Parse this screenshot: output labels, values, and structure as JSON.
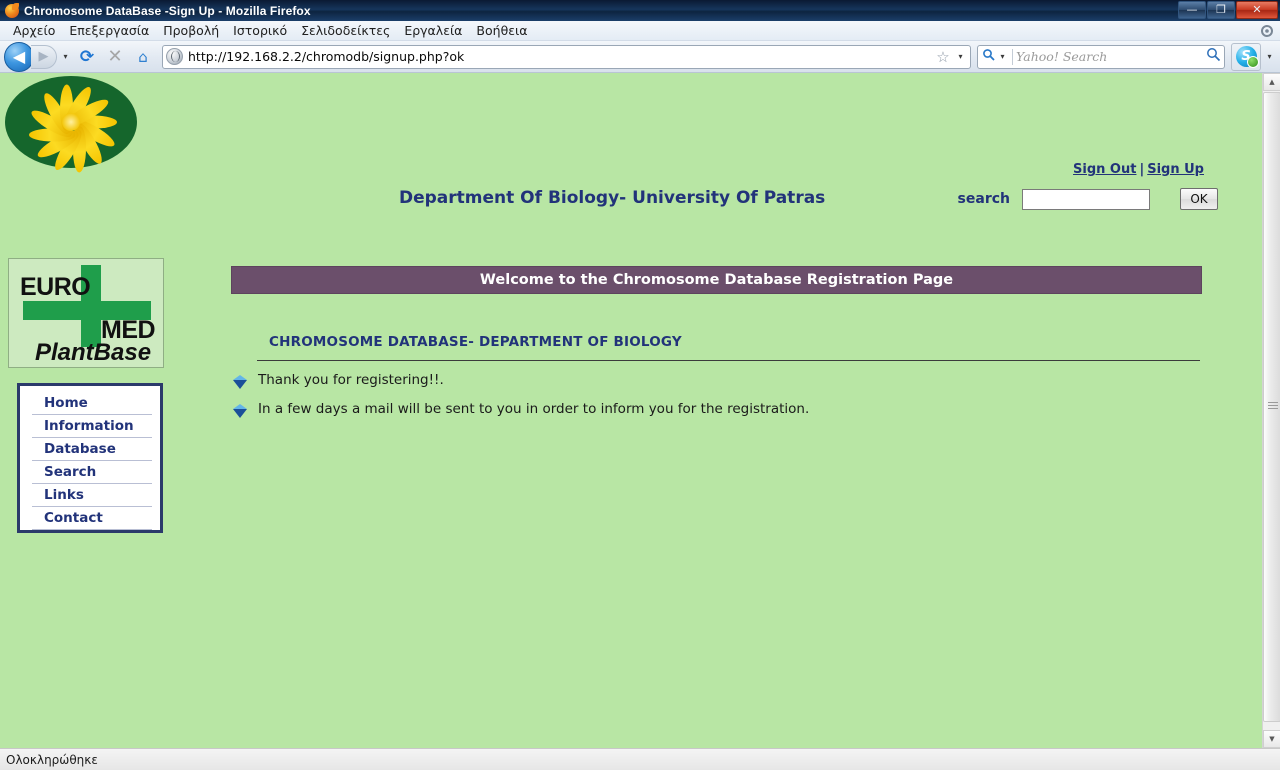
{
  "window": {
    "title": "Chromosome DataBase -Sign Up - Mozilla Firefox",
    "app_icon": "firefox-icon",
    "minimize_label": "—",
    "restore_label": "❐",
    "close_label": "✕"
  },
  "menubar": {
    "items": [
      {
        "label": "Αρχείο",
        "accel": "Α"
      },
      {
        "label": "Επεξεργασία",
        "accel": "Ε"
      },
      {
        "label": "Προβολή",
        "accel": "Π"
      },
      {
        "label": "Ιστορικό",
        "accel": "Ι"
      },
      {
        "label": "Σελιδοδείκτες",
        "accel": "Σ"
      },
      {
        "label": "Εργαλεία",
        "accel": ""
      },
      {
        "label": "Βοήθεια",
        "accel": "Β"
      }
    ]
  },
  "toolbar": {
    "back_label": "◀",
    "forward_label": "▶",
    "dropdown_label": "▾",
    "reload_label": "⟳",
    "stop_label": "✕",
    "home_label": "⌂",
    "url": "http://192.168.2.2/chromodb/signup.php?ok",
    "star_label": "☆",
    "star_dropdown_label": "▾",
    "search_engine_label": "🔍",
    "search_dropdown_label": "▾",
    "search_placeholder": "Yahoo! Search",
    "search_value": "",
    "search_go_label": "🔎",
    "skype_label": "S",
    "skype_dropdown_label": "▾"
  },
  "page": {
    "header": {
      "logo_alt": "yellow-flower-logo",
      "site_title": "Department Of Biology- University Of Patras",
      "sign_out": "Sign Out",
      "separator": "|",
      "sign_up": "Sign Up",
      "search_label": "search",
      "search_value": "",
      "search_placeholder": "",
      "ok_button": "OK"
    },
    "plantbase_logo": {
      "euro": "EURO",
      "med": "MED",
      "plantbase": "PlantBase"
    },
    "nav": {
      "items": [
        {
          "label": "Home"
        },
        {
          "label": "Information"
        },
        {
          "label": "Database"
        },
        {
          "label": "Search"
        },
        {
          "label": "Links"
        },
        {
          "label": "Contact"
        }
      ]
    },
    "banner": "Welcome to the Chromosome Database Registration Page",
    "section_title": "CHROMOSOME DATABASE- DEPARTMENT OF BIOLOGY",
    "messages": [
      "Thank you for registering!!.",
      "In a few days a mail will be sent to you in order to inform you for the registration."
    ]
  },
  "scrollbar": {
    "up_label": "▲",
    "down_label": "▼"
  },
  "statusbar": {
    "text": "Ολοκληρώθηκε"
  },
  "colors": {
    "page_background": "#b8e6a4",
    "banner_purple": "#6b4f6b",
    "heading_blue": "#22337a",
    "logo_green": "#15662c",
    "cross_green": "#1f9e4b",
    "petal_yellow": "#f3c70c"
  }
}
